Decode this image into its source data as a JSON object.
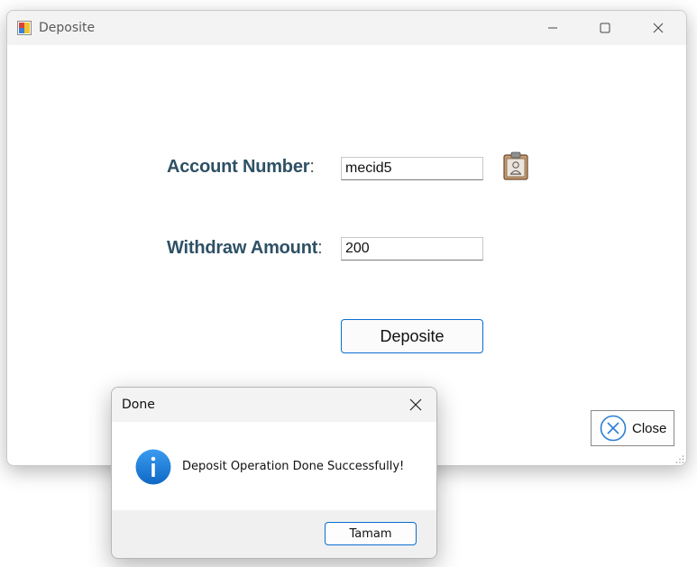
{
  "window": {
    "title": "Deposite",
    "icon": "winforms-app-icon",
    "controls": [
      "minimize-icon",
      "maximize-icon",
      "close-icon"
    ]
  },
  "form": {
    "account_label": "Account Number",
    "account_value": "mecid5",
    "amount_label": "Withdraw Amount",
    "amount_value": "200",
    "colon": ":",
    "lookup_icon": "id-badge-icon",
    "deposit_button": "Deposite",
    "close_button": "Close",
    "close_icon": "circle-x-icon"
  },
  "dialog": {
    "title": "Done",
    "message": "Deposit Operation Done Successfully!",
    "icon": "info-icon",
    "ok_button": "Tamam"
  },
  "colors": {
    "label_text": "#2e5065",
    "accent_border": "#0a6ed1",
    "info_blue": "#1a7fd8",
    "titlebar_bg": "#f3f3f3"
  }
}
